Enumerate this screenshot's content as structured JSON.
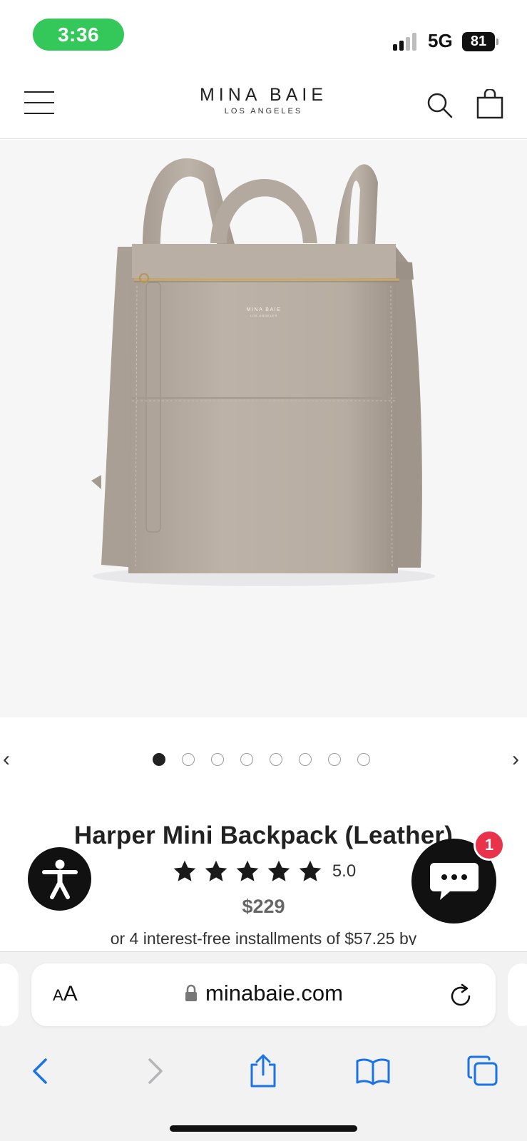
{
  "status_bar": {
    "time": "3:36",
    "network": "5G",
    "battery": "81"
  },
  "header": {
    "logo_main": "MINA BAIE",
    "logo_sub": "LOS ANGELES",
    "icons": {
      "menu": "hamburger-menu-icon",
      "search": "search-icon",
      "cart": "shopping-bag-icon"
    }
  },
  "product": {
    "image_brand_mark": "MINA BAIE",
    "image_brand_sub": "LOS ANGELES",
    "title": "Harper Mini Backpack (Leather)",
    "rating_value": "5.0",
    "rating_stars": 5,
    "price": "$229",
    "installments": "or 4 interest-free installments of $57.25 by"
  },
  "carousel": {
    "prev_label": "‹",
    "next_label": "›",
    "dots_total": 8,
    "active_index": 0
  },
  "floating": {
    "chat_badge": "1",
    "accessibility_icon": "accessibility-icon",
    "chat_icon": "chat-bubble-icon"
  },
  "browser": {
    "aa_label_small": "A",
    "aa_label_big": "A",
    "url": "minabaie.com",
    "toolbar_icons": [
      "back-icon",
      "forward-icon",
      "share-icon",
      "bookmarks-icon",
      "tabs-icon"
    ]
  },
  "colors": {
    "status_green": "#34c759",
    "badge_red": "#e8334a",
    "safari_blue": "#1a73e8",
    "bag_taupe": "#b8aea3"
  }
}
